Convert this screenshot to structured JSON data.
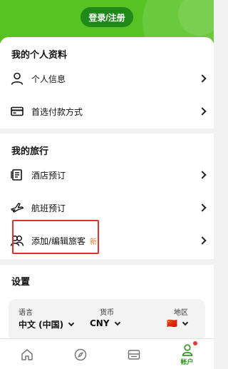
{
  "header": {
    "login_label": "登录/注册",
    "brand_color": "#57c224"
  },
  "profile": {
    "title": "我的个人资料",
    "items": [
      {
        "label": "个人信息",
        "icon": "person-icon"
      },
      {
        "label": "首选付款方式",
        "icon": "credit-card-icon"
      }
    ]
  },
  "trip": {
    "title": "我的旅行",
    "items": [
      {
        "label": "酒店预订",
        "icon": "hotel-receipt-icon"
      },
      {
        "label": "航班预订",
        "icon": "airplane-icon"
      },
      {
        "label": "添加/编辑旅客",
        "icon": "travelers-icon",
        "badge": "新"
      }
    ]
  },
  "settings": {
    "title": "设置",
    "language": {
      "label": "语言",
      "value": "中文 (中国)"
    },
    "currency": {
      "label": "货币",
      "value": "CNY"
    },
    "region": {
      "label": "地区",
      "value": "🇨🇳"
    }
  },
  "tabbar": {
    "tabs": [
      {
        "icon": "home-icon"
      },
      {
        "icon": "compass-icon"
      },
      {
        "icon": "bookings-icon"
      },
      {
        "icon": "account-icon",
        "label": "帐户",
        "active": true
      }
    ],
    "active_color": "#2e9a1f"
  },
  "annotation": {
    "highlight_color": "#e03030"
  }
}
